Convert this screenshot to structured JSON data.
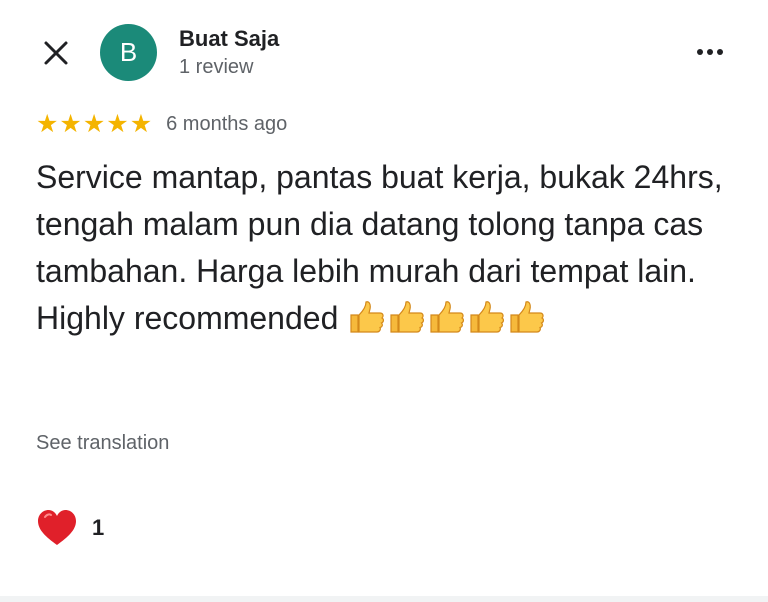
{
  "header": {
    "close_icon": "close-icon",
    "more_icon": "more-horizontal-icon"
  },
  "author": {
    "avatar_letter": "B",
    "avatar_color": "#1b8a79",
    "name": "Buat Saja",
    "meta": "1 review"
  },
  "rating": {
    "stars": 5,
    "star_glyph": "★",
    "star_color": "#f4b400",
    "date": "6 months ago"
  },
  "review": {
    "text": "Service mantap, pantas buat kerja, bukak 24hrs, tengah malam pun dia datang tolong tanpa cas tambahan. Harga lebih murah dari tempat lain. Highly recommended",
    "trailing_icons": [
      "thumbs-up-icon",
      "thumbs-up-icon",
      "thumbs-up-icon",
      "thumbs-up-icon",
      "thumbs-up-icon"
    ]
  },
  "actions": {
    "see_translation": "See translation"
  },
  "reactions": {
    "icon": "heart-icon",
    "heart_color": "#e0202a",
    "count": "1"
  }
}
